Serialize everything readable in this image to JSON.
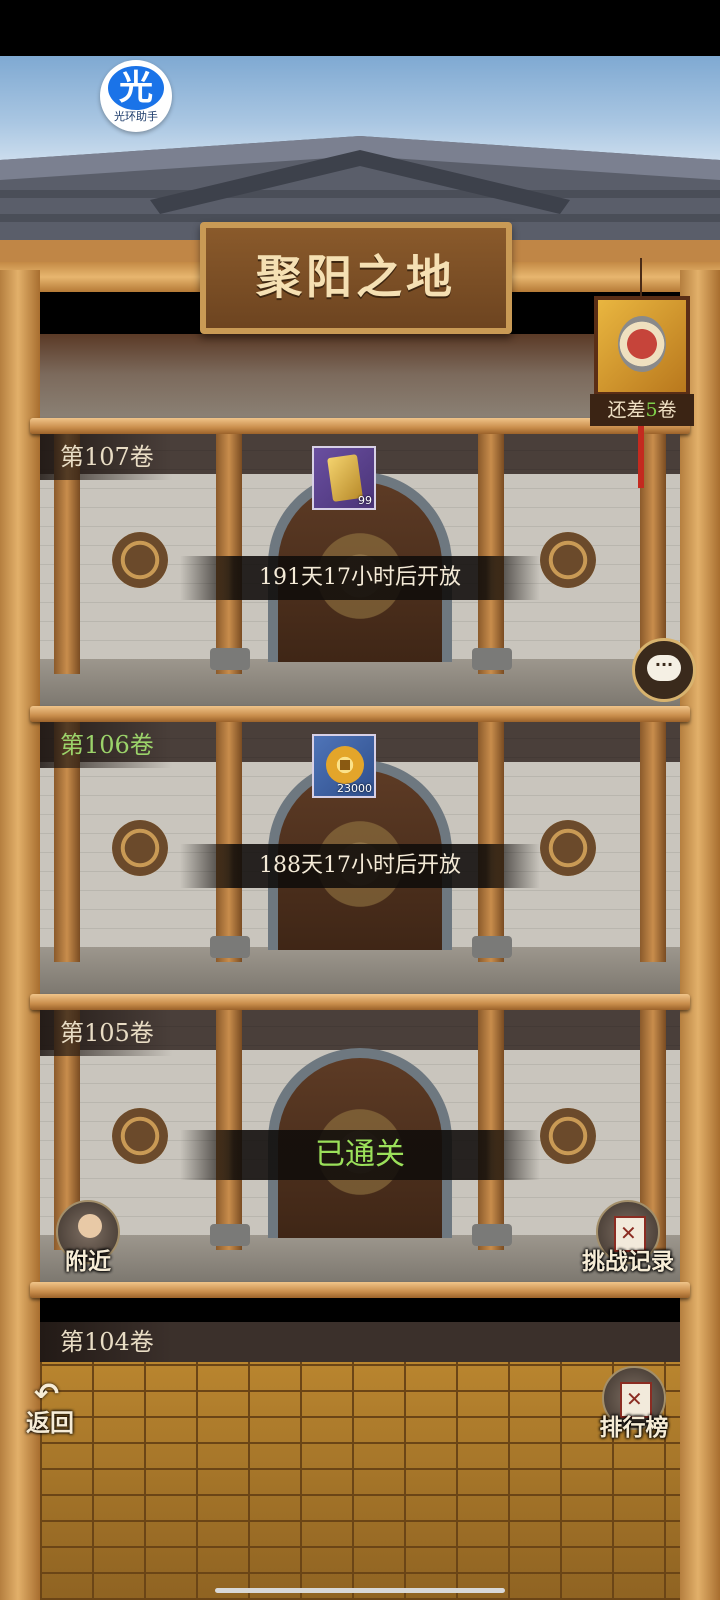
{
  "assistant": {
    "glyph": "光",
    "caption": "光环助手"
  },
  "title": "聚阳之地",
  "progress_lantern": {
    "prefix": "还差",
    "count": "5",
    "suffix": "卷"
  },
  "levels": [
    {
      "label": "第107卷",
      "status": "191天17小时后开放",
      "reward": {
        "type": "card",
        "qty": "99"
      }
    },
    {
      "label": "第106卷",
      "status": "188天17小时后开放",
      "reward": {
        "type": "coin",
        "qty": "23000"
      }
    },
    {
      "label": "第105卷",
      "status": "已通关"
    },
    {
      "label": "第104卷"
    }
  ],
  "buttons": {
    "chat_icon": "···",
    "nearby": "附近",
    "challenge_record": "挑战记录",
    "ranking": "排行榜",
    "back": "返回"
  },
  "colors": {
    "cleared": "#9be05a",
    "current_level": "#9bd36a",
    "count_highlight": "#7ed04a"
  }
}
